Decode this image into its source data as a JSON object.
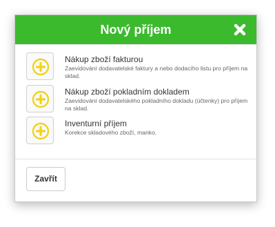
{
  "dialog": {
    "title": "Nový příjem",
    "close_icon": "close-x-icon",
    "accent_color": "#3cba2e",
    "icon_color": "#f2d21b"
  },
  "options": [
    {
      "title": "Nákup zboží fakturou",
      "description": "Zaevidování dodavatelské faktury a nebo dodacího listu pro příjem na sklad.",
      "icon": "plus-circle-icon"
    },
    {
      "title": "Nákup zboží pokladním dokladem",
      "description": "Zaevidování dodavatelského pokladního dokladu (účtenky) pro příjem na sklad.",
      "icon": "plus-circle-icon"
    },
    {
      "title": "Inventurní příjem",
      "description": "Korekce skladového zboží, manko.",
      "icon": "plus-circle-icon"
    }
  ],
  "footer": {
    "close_label": "Zavřít"
  }
}
